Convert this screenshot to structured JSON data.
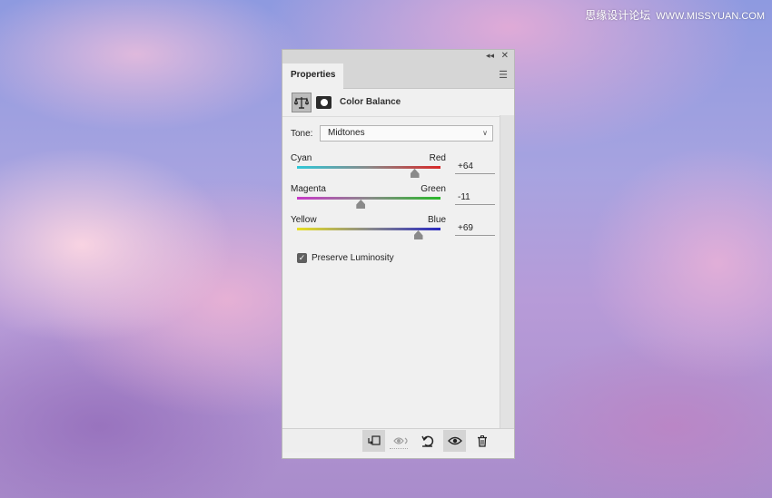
{
  "watermark": {
    "site": "思缘设计论坛",
    "url": "WWW.MISSYUAN.COM"
  },
  "panel": {
    "tab_label": "Properties",
    "menu_icon": "hamburger-menu-icon",
    "collapse_glyph": "◂◂",
    "close_glyph": "✕"
  },
  "adjustment": {
    "title": "Color Balance",
    "icon": "balance-scale-icon",
    "mask_icon": "layer-mask-icon"
  },
  "tone": {
    "label": "Tone:",
    "value": "Midtones"
  },
  "sliders": [
    {
      "left_label": "Cyan",
      "right_label": "Red",
      "value_text": "+64",
      "value": 64,
      "min": -100,
      "max": 100,
      "colors": [
        "#30c8d8",
        "#d82828"
      ]
    },
    {
      "left_label": "Magenta",
      "right_label": "Green",
      "value_text": "-11",
      "value": -11,
      "min": -100,
      "max": 100,
      "colors": [
        "#c838c8",
        "#28b828"
      ]
    },
    {
      "left_label": "Yellow",
      "right_label": "Blue",
      "value_text": "+69",
      "value": 69,
      "min": -100,
      "max": 100,
      "colors": [
        "#e8e020",
        "#2828c0"
      ]
    }
  ],
  "preserve_luminosity": {
    "label": "Preserve Luminosity",
    "checked": true
  },
  "footer": {
    "icons": [
      "clip-to-layer-icon",
      "view-previous-state-icon",
      "reset-icon",
      "visibility-eye-icon",
      "delete-trash-icon"
    ]
  }
}
